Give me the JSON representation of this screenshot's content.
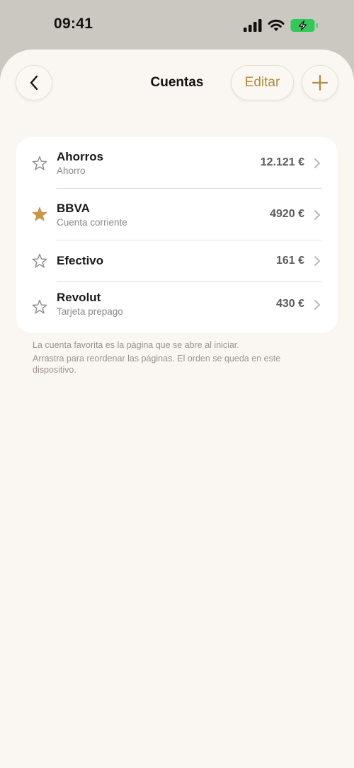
{
  "status_bar": {
    "time": "09:41",
    "icons": [
      "signal-icon",
      "wifi-icon",
      "battery-charging-icon"
    ],
    "battery_color": "#34c759"
  },
  "header": {
    "back_icon": "chevron-left-icon",
    "title": "Cuentas",
    "edit_label": "Editar",
    "add_icon": "plus-icon"
  },
  "colors": {
    "accent": "#b08a3e",
    "favorite_star": "#c9974a",
    "background": "#faf6f1"
  },
  "accounts": [
    {
      "name": "Ahorros",
      "subtitle": "Ahorro",
      "amount": "12.121 €",
      "favorite": false
    },
    {
      "name": "BBVA",
      "subtitle": "Cuenta corriente",
      "amount": "4920 €",
      "favorite": true
    },
    {
      "name": "Efectivo",
      "subtitle": "",
      "amount": "161 €",
      "favorite": false
    },
    {
      "name": "Revolut",
      "subtitle": "Tarjeta prepago",
      "amount": "430 €",
      "favorite": false
    }
  ],
  "footer": {
    "line1": "La cuenta favorita es la página que se abre al iniciar.",
    "line2": "Arrastra para reordenar las páginas. El orden se queda en este dispositivo."
  }
}
